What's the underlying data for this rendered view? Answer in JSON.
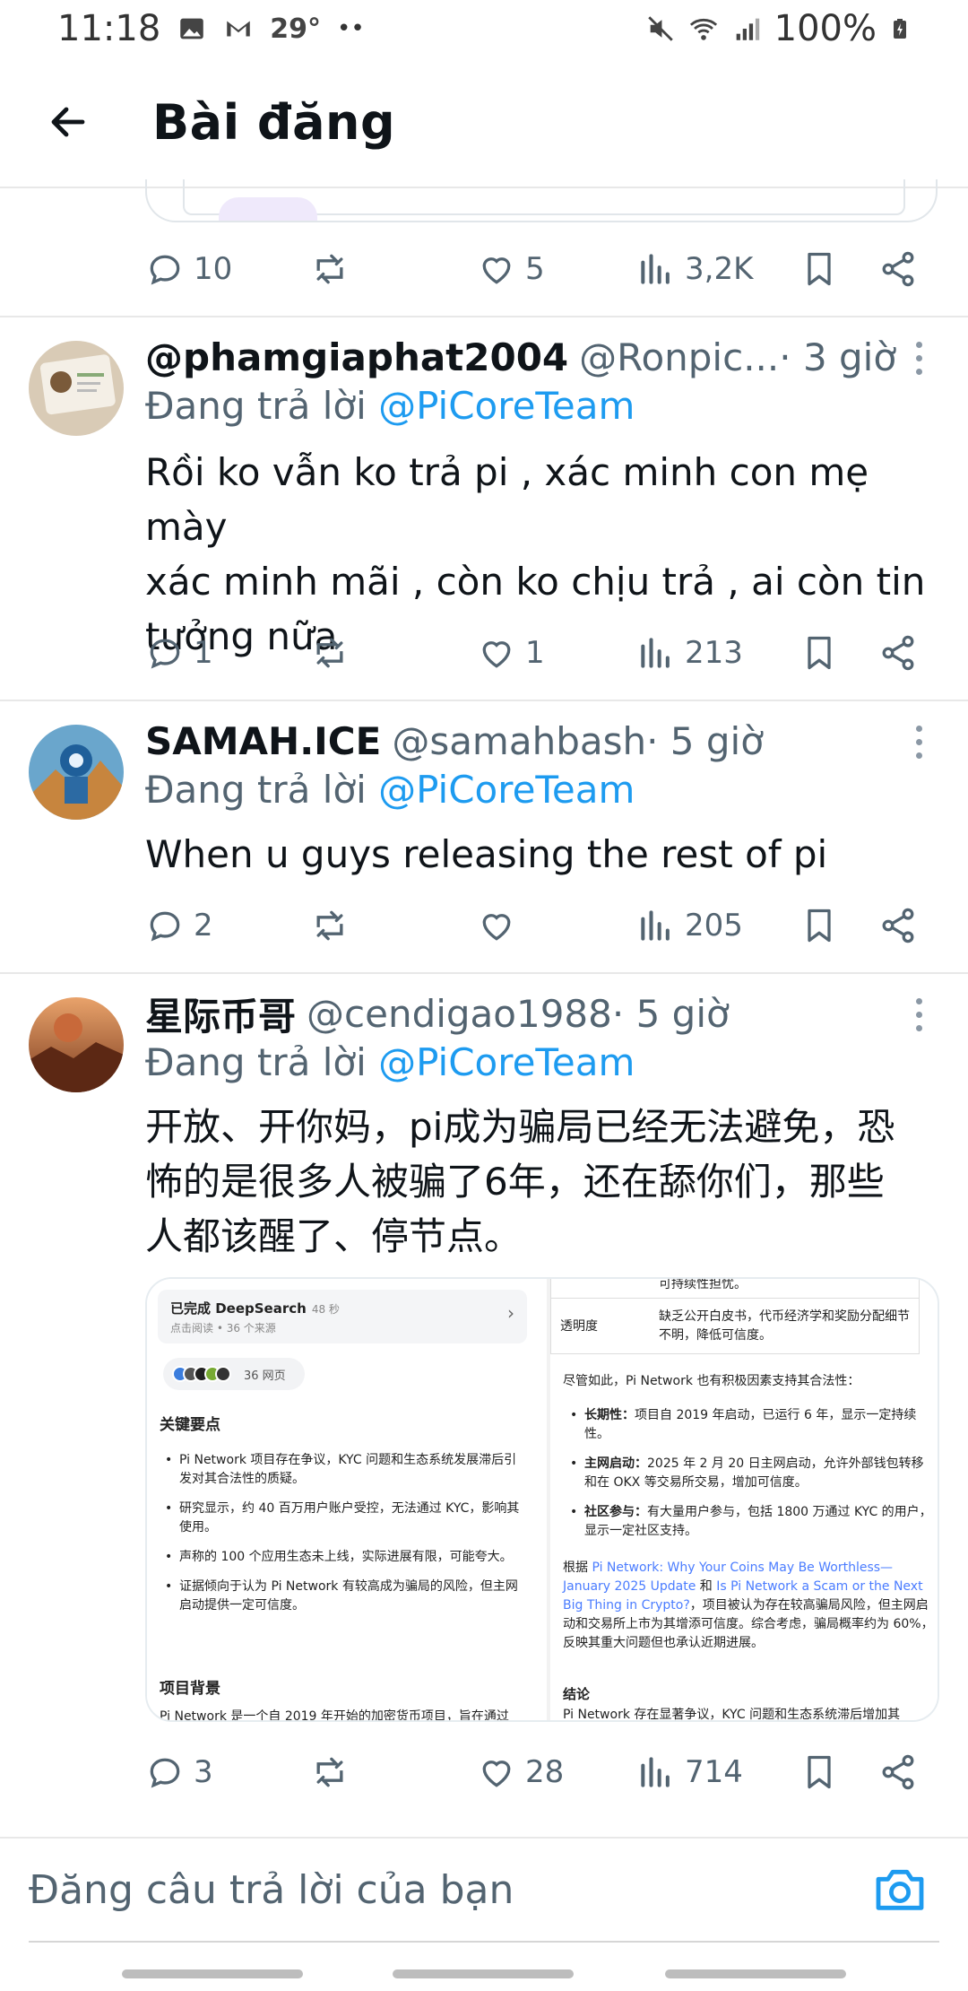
{
  "status_bar": {
    "time": "11:18",
    "temperature": "29°",
    "dots": "••",
    "battery": "100%"
  },
  "header": {
    "title": "Bài đăng"
  },
  "previous_tweet": {
    "replies": "10",
    "likes": "5",
    "views": "3,2K"
  },
  "tweets": [
    {
      "name": "@phamgiaphat2004",
      "handle": "@Ronpic...",
      "time": " · 3 giờ",
      "reply_prefix": "Đang trả lời ",
      "reply_to": "@PiCoreTeam",
      "text_lines": [
        "Rồi ko vẫn ko trả pi , xác minh con mẹ mày",
        "xác minh mãi , còn ko chịu  trả , ai còn tin",
        "tưởng nữa"
      ],
      "replies": "1",
      "likes": "1",
      "views": "213"
    },
    {
      "name": "SAMAH.ICE",
      "handle": "@samahbash",
      "time": " · 5 giờ",
      "reply_prefix": "Đang trả lời ",
      "reply_to": "@PiCoreTeam",
      "text_lines": [
        "When u guys releasing the rest of pi"
      ],
      "replies": "2",
      "likes": "",
      "views": "205"
    },
    {
      "name": "星际币哥",
      "handle": "@cendigao1988",
      "time": " · 5 giờ",
      "reply_prefix": "Đang trả lời ",
      "reply_to": "@PiCoreTeam",
      "text_lines": [
        "开放、开你妈，pi成为骗局已经无法避免，恐",
        "怖的是很多人被骗了6年，还在舔你们，那些",
        "人都该醒了、停节点。"
      ],
      "replies": "3",
      "likes": "28",
      "views": "714"
    }
  ],
  "media": {
    "left": {
      "ds_title": "已完成 DeepSearch",
      "ds_time": "48 秒",
      "ds_sub": "点击阅读 • 36 个来源",
      "pill_text": "36 网页",
      "heading1": "关键要点",
      "bullets": [
        "Pi Network 项目存在争议，KYC 问题和生态系统发展滞后引发对其合法性的质疑。",
        "研究显示，约 40 百万用户账户受控，无法通过 KYC，影响其使用。",
        "声称的 100 个应用生态未上线，实际进展有限，可能夸大。",
        "证据倾向于认为 Pi Network 有较高成为骗局的风险，但主网启动提供一定可信度。"
      ],
      "heading2": "项目背景",
      "para": "Pi Network 是一个自 2019 年开始的加密货币项目，旨在通过"
    },
    "right": {
      "table_top": "可持续性担忧。",
      "row_label": "透明度",
      "row_value": "缺乏公开白皮书，代币经济学和奖励分配细节不明，降低可信度。",
      "intro": "尽管如此，Pi Network 也有积极因素支持其合法性：",
      "bullets": [
        {
          "bold": "长期性：",
          "text": "项目自 2019 年启动，已运行 6 年，显示一定持续性。"
        },
        {
          "bold": "主网启动：",
          "text": "2025 年 2 月 20 日主网启动，允许外部钱包转移和在 OKX 等交易所交易，增加可信度。"
        },
        {
          "bold": "社区参与：",
          "text": "有大量用户参与，包括 1800 万通过 KYC 的用户，显示一定社区支持。"
        }
      ],
      "para_prefix": "根据 ",
      "link1": "Pi Network: Why Your Coins May Be Worthless—January 2025 Update",
      "para_mid": " 和 ",
      "link2": "Is Pi Network a Scam or the Next Big Thing in Crypto?",
      "para_suffix": "，项目被认为存在较高骗局风险，但主网启动和交易所上市为其增添可信度。综合考虑，骗局概率约为 60%，反映其重大问题但也承认近期进展。",
      "heading": "结论",
      "last": "Pi Network 存在显著争议，KYC 问题和生态系统滞后增加其"
    }
  },
  "composer": {
    "placeholder": "Đăng câu trả lời của bạn"
  },
  "colors": {
    "accent": "#1d9bf0",
    "muted": "#536471",
    "text": "#0f1419"
  }
}
